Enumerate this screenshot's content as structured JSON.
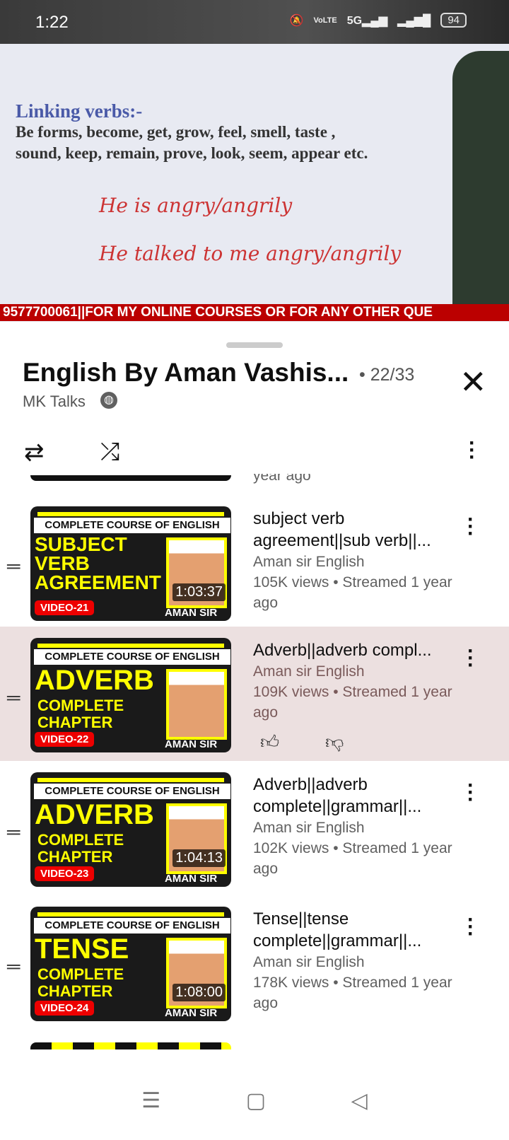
{
  "status": {
    "time": "1:22",
    "icons": [
      "mute-icon",
      "volte-icon",
      "5g-signal-icon",
      "signal-icon"
    ],
    "battery": "94",
    "network": "5G"
  },
  "video": {
    "heading": "Linking verbs:-",
    "lines": [
      "Be forms, become, get, grow, feel, smell, taste ,",
      "sound, keep, remain, prove, look, seem, appear etc."
    ],
    "handwriting": [
      "He is angry/angrily",
      "He talked to me angry/angrily"
    ],
    "ticker": "9577700061||FOR MY ONLINE COURSES OR FOR ANY OTHER QUE"
  },
  "playlist": {
    "title": "English By Aman Vashis...",
    "count": "• 22/33",
    "channel": "MK Talks",
    "partial_prev": "year ago"
  },
  "items": [
    {
      "cc": "COMPLETE COURSE OF ENGLISH",
      "big": "SUBJECT VERB AGREEMENT",
      "sub": "",
      "video": "VIDEO-21",
      "aman": "AMAN SIR",
      "duration": "1:03:37",
      "title": "subject verb agreement||sub verb||...",
      "channel": "Aman sir English",
      "meta": "105K views • Streamed 1 year ago"
    },
    {
      "cc": "COMPLETE COURSE OF ENGLISH",
      "big": "ADVERB",
      "sub": "COMPLETE CHAPTER",
      "video": "VIDEO-22",
      "aman": "AMAN SIR",
      "duration": "",
      "title": "Adverb||adverb compl...",
      "channel": "Aman sir English",
      "meta": "109K views • Streamed 1 year ago"
    },
    {
      "cc": "COMPLETE COURSE OF ENGLISH",
      "big": "ADVERB",
      "sub": "COMPLETE CHAPTER",
      "video": "VIDEO-23",
      "aman": "AMAN SIR",
      "duration": "1:04:13",
      "title": "Adverb||adverb complete||grammar||...",
      "channel": "Aman sir English",
      "meta": "102K views • Streamed 1 year ago"
    },
    {
      "cc": "COMPLETE COURSE OF ENGLISH",
      "big": "TENSE",
      "sub": "COMPLETE CHAPTER",
      "video": "VIDEO-24",
      "aman": "AMAN SIR",
      "duration": "1:08:00",
      "title": "Tense||tense complete||grammar||...",
      "channel": "Aman sir English",
      "meta": "178K views • Streamed 1 year ago"
    }
  ],
  "colors": {
    "active_row": "#ece0e0",
    "ticker": "#bb0000",
    "thumb_yellow": "#ffff00"
  }
}
